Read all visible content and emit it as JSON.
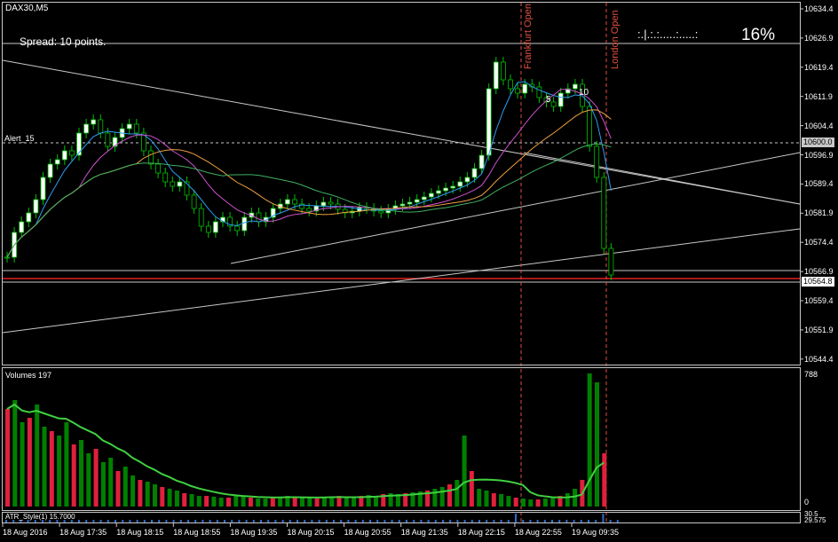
{
  "chart": {
    "symbol": "DAX30,M5",
    "spread_text": "Spread: 10 points.",
    "alert_label": "Alert_15",
    "progress_text": ":.|.:.:.....:.....:",
    "progress_percent": "16%",
    "frankfurt_label": "Frankfurt Open",
    "london_label": "London Open",
    "bar_label_5": "5",
    "bar_label_10": "10"
  },
  "price_axis": {
    "ticks": [
      "10634.4",
      "10626.9",
      "10619.4",
      "10611.9",
      "10604.4",
      "10596.9",
      "10589.4",
      "10581.9",
      "10574.4",
      "10566.9",
      "10559.4",
      "10551.9",
      "10544.4"
    ],
    "alert_price": "10600.0",
    "current_price": "10564.8"
  },
  "volume_panel": {
    "label": "Volumes 197",
    "max_tick": "788",
    "min_tick": "0"
  },
  "atr_panel": {
    "label": "ATR_Style(1) 15.7000",
    "tick_a": "30.5",
    "tick_b": "29.575"
  },
  "time_axis": {
    "labels": [
      "18 Aug 2016",
      "18 Aug 17:35",
      "18 Aug 18:15",
      "18 Aug 18:55",
      "18 Aug 19:35",
      "18 Aug 20:15",
      "18 Aug 20:55",
      "18 Aug 21:35",
      "18 Aug 22:15",
      "18 Aug 22:55",
      "19 Aug 09:35"
    ]
  },
  "colors": {
    "background": "#000000",
    "bull_candle": "#ffffff",
    "bear_candle": "#000000",
    "candle_wick": "#00c000",
    "volume_up": "#008000",
    "volume_down": "#e0203c",
    "session_line": "#e05040",
    "ma_fast": "#2c9cf0",
    "ma_mid": "#d050d0",
    "ma_slow": "#f0a040",
    "ma_long": "#40b060",
    "current_price_line": "#e02020"
  }
}
